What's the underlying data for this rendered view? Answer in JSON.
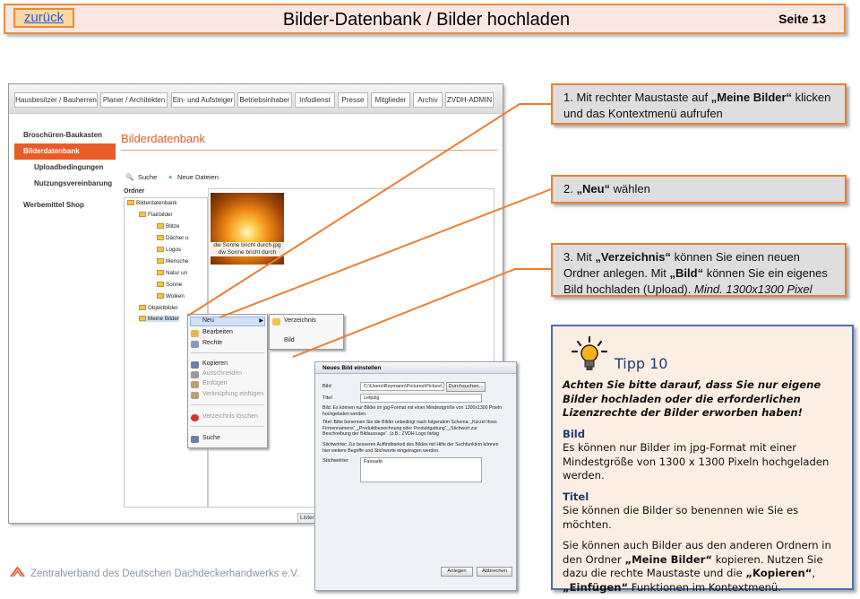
{
  "header": {
    "back_label": "zurück",
    "title": "Bilder-Datenbank / Bilder hochladen",
    "page_label": "Seite 13"
  },
  "steps": {
    "step1": {
      "num": "1.",
      "pre": "Mit rechter Maustaste auf ",
      "bold": "„Meine Bilder“",
      "post": " klicken und das Kontextmenü aufrufen"
    },
    "step2": {
      "num": "2.",
      "bold": "„Neu“",
      "post": " wählen"
    },
    "step3": {
      "num": "3.",
      "pre": "Mit ",
      "bold1": "„Verzeichnis“",
      "mid": " können Sie einen neuen Ordner anlegen. Mit ",
      "bold2": "„Bild“",
      "post": " können Sie ein eigenes Bild hochladen (Upload). ",
      "italic": "Mind. 1300x1300 Pixel"
    }
  },
  "tip": {
    "title": "Tipp 10",
    "lead": "Achten Sie bitte darauf, dass Sie nur eigene Bilder hochladen oder die erforderlichen Lizenzrechte der Bilder erworben haben!",
    "bild_head": "Bild",
    "bild_text": "Es können nur Bilder im jpg-Format mit einer Mindestgröße von 1300 x 1300 Pixeln hochgeladen werden.",
    "titel_head": "Titel",
    "titel_text": "Sie können die Bilder so benennen wie Sie es möchten.",
    "copy_pre": "Sie können auch Bilder aus den anderen Ordnern in den Ordner ",
    "copy_b1": "„Meine Bilder“",
    "copy_mid": " kopieren. Nutzen Sie dazu die rechte Maustaste und die ",
    "copy_b2": "„Kopieren“",
    "copy_sep": ", ",
    "copy_b3": "„Einfügen“",
    "copy_post": " Funktionen im Kontextmenü."
  },
  "screenshot": {
    "nav": [
      "Hausbesitzer / Bauherren",
      "Planer / Architekten",
      "Ein- und Aufsteiger",
      "Betriebsinhaber",
      "Infodienst",
      "Presse",
      "Mitglieder",
      "Archiv",
      "ZVDH-ADMIN"
    ],
    "sidebar": [
      "Broschüren-Baukasten",
      "Bilderdatenbank",
      "Uploadbedingungen",
      "Nutzungsvereinbarung",
      "Werbemittel Shop"
    ],
    "db_title": "Bilderdatenbank",
    "toolbar": {
      "search": "Suche",
      "new_files": "Neue Dateien"
    },
    "ordner": "Ordner",
    "tree": [
      "Bilderdatenbank",
      "Flairbilder",
      "Blitze",
      "Dächer u",
      "Logos",
      "Mensche",
      "Natur un",
      "Sonne",
      "Wolken",
      "Objektbilder",
      "Meine Bilder"
    ],
    "thumb_caption": "dw Sonne bricht durch.jpg dw Sonne bricht durch",
    "context_menu": [
      "Neu",
      "Bearbeiten",
      "Rechte",
      "Kopieren",
      "Ausschneiden",
      "Einfügen",
      "Verknüpfung einfügen",
      "Verzeichnis löschen",
      "Suche"
    ],
    "submenu": [
      "Verzeichnis",
      "Bild"
    ],
    "dialog": {
      "title": "Neues Bild einstellen",
      "bild_label": "Bild",
      "bild_value": "C:\\Users\\Boymann\\Pictures\\Picture\\",
      "browse": "Durchsuchen...",
      "titel_label": "Titel",
      "titel_value": "Leipzig",
      "note1": "Bild: Es können nur Bilder im jpg-Format mit einer Mindestgröße von 1300x1300 Pixeln hochgeladen werden.",
      "note2": "Titel: Bitte benennen Sie die Bilder unbedingt nach folgendem Schema: „Kürzel Ihres Firmennamens“_„Produktbezeichnung oder Produktgattung“_„Stichwort zur Beschreibung der Bildaussage“. (z.B.: ZVDH Logo farbig",
      "note3": "Stichwörter: Zur besseren Auffindbarkeit des Bildes mit Hilfe der Suchfunktion können hier weitere Begriffe und Stichworte eingetragen werden.",
      "stich_label": "Stichwörter",
      "stich_value": "Fassade",
      "ok": "Anlegen",
      "cancel": "Abbrechen"
    },
    "status": "Listen"
  },
  "footer": {
    "org": "Zentralverband des Deutschen Dachdeckerhandwerks e.V."
  },
  "colors": {
    "accent": "#ed7d31",
    "tip_border": "#4a6fb3",
    "active": "#ea5b2a"
  }
}
